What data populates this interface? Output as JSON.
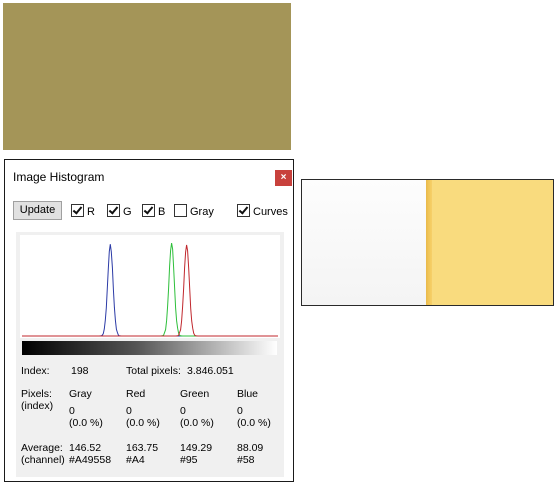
{
  "colors": {
    "swatch": "#A49558",
    "photo_yellow": "#F9DB7E",
    "red_curve": "#c0272d",
    "green_curve": "#2dbf3a",
    "blue_curve": "#2b3aa6"
  },
  "window": {
    "title": "Image Histogram",
    "close_label": "×",
    "update_label": "Update",
    "checkboxes": [
      {
        "label": "R",
        "checked": true
      },
      {
        "label": "G",
        "checked": true
      },
      {
        "label": "B",
        "checked": true
      },
      {
        "label": "Gray",
        "checked": false
      },
      {
        "label": "Curves",
        "checked": true
      }
    ]
  },
  "chart_data": {
    "type": "line",
    "xlim": [
      0,
      255
    ],
    "series": [
      {
        "name": "B",
        "peak_x": 88,
        "peak_y": 0.95
      },
      {
        "name": "G",
        "peak_x": 149,
        "peak_y": 0.97
      },
      {
        "name": "R",
        "peak_x": 164,
        "peak_y": 0.95
      }
    ]
  },
  "stats": {
    "index_label": "Index:",
    "index_value": "198",
    "total_label": "Total pixels:",
    "total_value": "3.846.051",
    "pixels_label": "Pixels:",
    "pixels_sub": "(index)",
    "columns": [
      "Gray",
      "Red",
      "Green",
      "Blue"
    ],
    "pixel_counts": [
      "0",
      "0",
      "0",
      "0"
    ],
    "pixel_pcts": [
      "(0.0 %)",
      "(0.0 %)",
      "(0.0 %)",
      "(0.0 %)"
    ],
    "avg_label": "Average:",
    "avg_sub": "(channel)",
    "averages": [
      "146.52",
      "163.75",
      "149.29",
      "88.09"
    ],
    "hexes": [
      "#A49558",
      "#A4",
      "#95",
      "#58"
    ]
  }
}
